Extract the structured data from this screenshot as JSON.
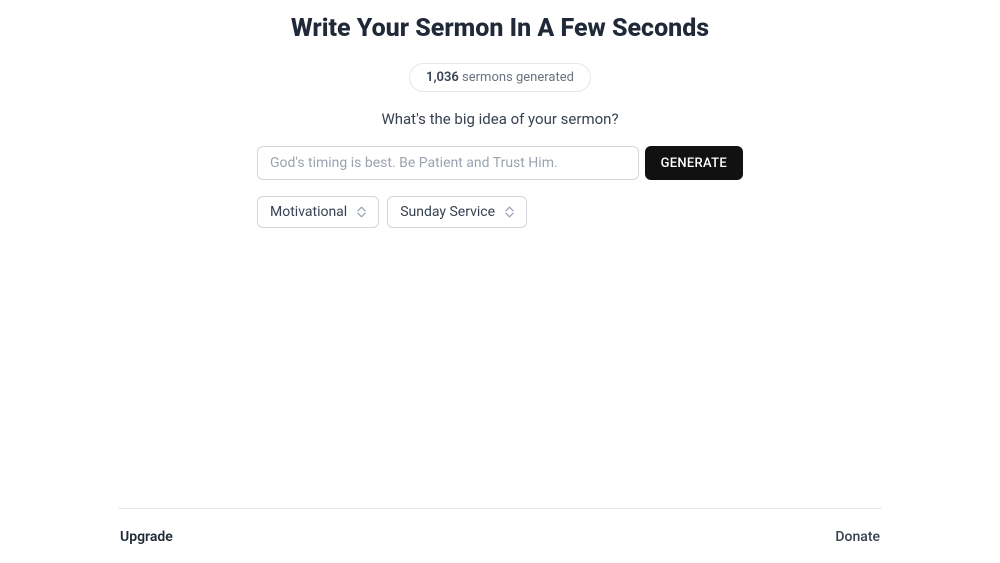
{
  "title": "Write Your Sermon In A Few Seconds",
  "badge": {
    "count": "1,036",
    "label": " sermons generated"
  },
  "prompt_label": "What's the big idea of your sermon?",
  "input": {
    "placeholder": "God's timing is best. Be Patient and Trust Him."
  },
  "generate_button": "GENERATE",
  "selects": {
    "tone": "Motivational",
    "occasion": "Sunday Service"
  },
  "footer": {
    "upgrade": "Upgrade",
    "donate": "Donate"
  }
}
